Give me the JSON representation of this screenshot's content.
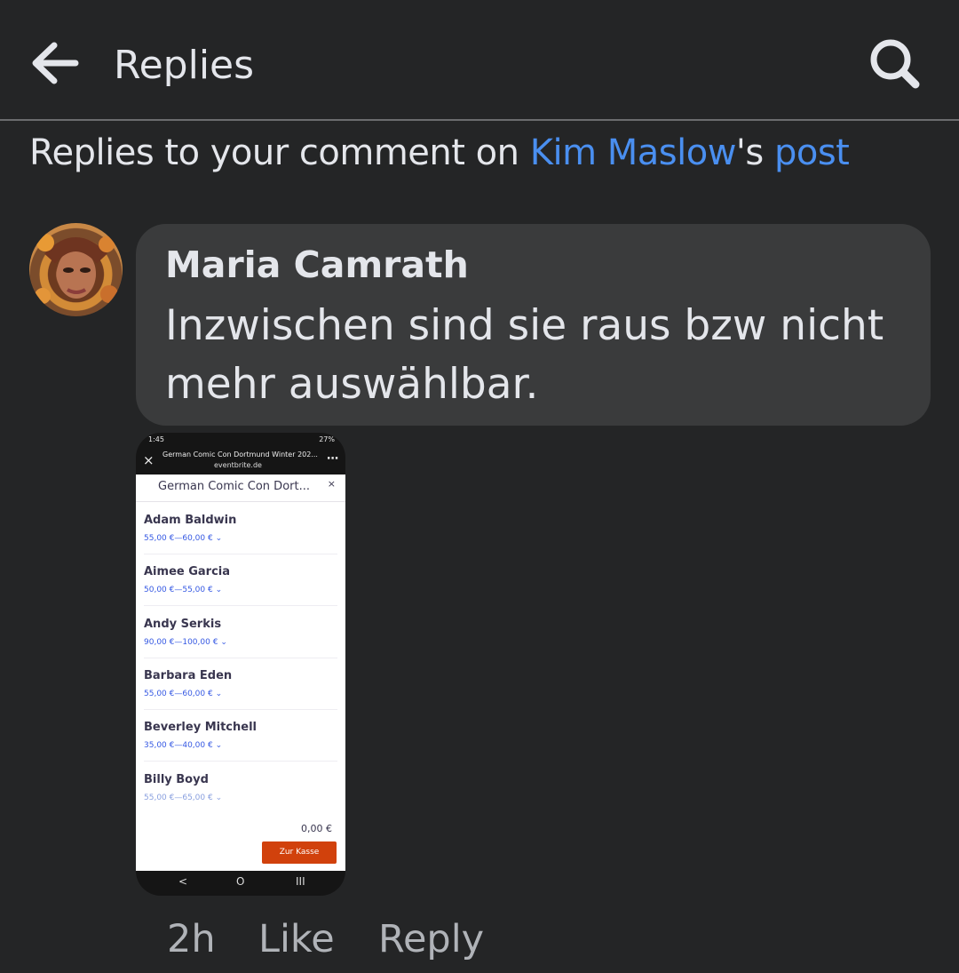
{
  "header": {
    "title": "Replies",
    "back_icon": "arrow-left-icon",
    "search_icon": "search-icon"
  },
  "context": {
    "prefix": "Replies to your comment on ",
    "person_link": "Kim Maslow",
    "possessive": "'s ",
    "post_link": "post"
  },
  "comment": {
    "author": "Maria Camrath",
    "text": "Inzwischen sind sie raus bzw nicht mehr auswählbar.",
    "time": "2h",
    "like_label": "Like",
    "reply_label": "Reply"
  },
  "screenshot_attachment": {
    "status_left": "1:45",
    "status_right": "27%",
    "browser_title": "German Comic Con Dortmund Winter 202...",
    "browser_url": "eventbrite.de",
    "event_title": "German Comic Con Dort...",
    "close_label": "×",
    "tickets": [
      {
        "name": "Adam Baldwin",
        "price": "55,00 €—60,00 €"
      },
      {
        "name": "Aimee Garcia",
        "price": "50,00 €—55,00 €"
      },
      {
        "name": "Andy Serkis",
        "price": "90,00 €—100,00 €"
      },
      {
        "name": "Barbara Eden",
        "price": "55,00 €—60,00 €"
      },
      {
        "name": "Beverley Mitchell",
        "price": "35,00 €—40,00 €"
      },
      {
        "name": "Billy Boyd",
        "price": "55,00 €—65,00 €"
      }
    ],
    "total": "0,00 €",
    "checkout_label": "Zur Kasse",
    "nav_back": "<",
    "nav_home": "O",
    "nav_recent": "III"
  },
  "colors": {
    "background": "#242526",
    "bubble": "#3a3b3c",
    "link": "#4a8ff0",
    "checkout": "#d1410c"
  }
}
